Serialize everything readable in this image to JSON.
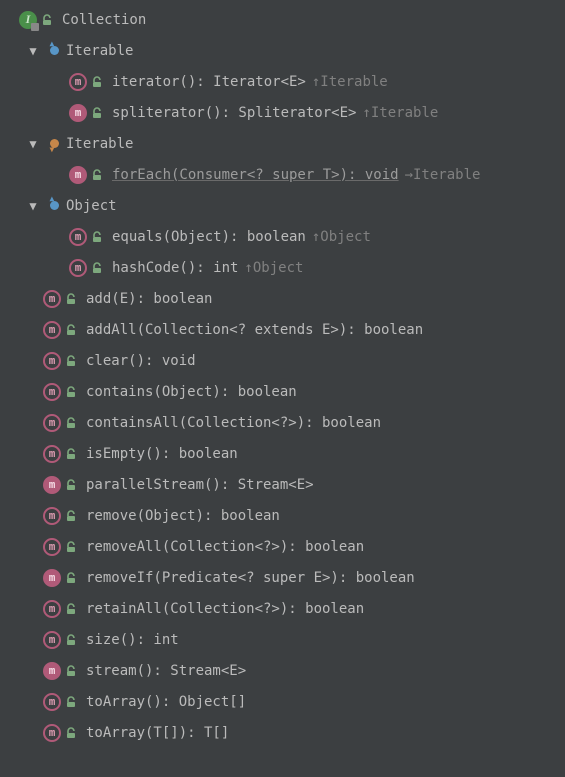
{
  "root": {
    "label": "Collection"
  },
  "groups": [
    {
      "label": "Iterable",
      "icon": "up-blue",
      "items": [
        {
          "abstract": true,
          "sig": "iterator(): Iterator<E>",
          "up": "↑Iterable"
        },
        {
          "abstract": false,
          "sig": "spliterator(): Spliterator<E>",
          "up": "↑Iterable"
        }
      ]
    },
    {
      "label": "Iterable",
      "icon": "down-orange",
      "items": [
        {
          "abstract": false,
          "sig": "forEach(Consumer<? super T>): void",
          "up": "→Iterable",
          "highlight": true
        }
      ]
    },
    {
      "label": "Object",
      "icon": "up-blue",
      "items": [
        {
          "abstract": true,
          "sig": "equals(Object): boolean",
          "up": "↑Object"
        },
        {
          "abstract": true,
          "sig": "hashCode(): int",
          "up": "↑Object"
        }
      ]
    }
  ],
  "methods": [
    {
      "abstract": true,
      "sig": "add(E): boolean"
    },
    {
      "abstract": true,
      "sig": "addAll(Collection<? extends E>): boolean"
    },
    {
      "abstract": true,
      "sig": "clear(): void"
    },
    {
      "abstract": true,
      "sig": "contains(Object): boolean"
    },
    {
      "abstract": true,
      "sig": "containsAll(Collection<?>): boolean"
    },
    {
      "abstract": true,
      "sig": "isEmpty(): boolean"
    },
    {
      "abstract": false,
      "sig": "parallelStream(): Stream<E>"
    },
    {
      "abstract": true,
      "sig": "remove(Object): boolean"
    },
    {
      "abstract": true,
      "sig": "removeAll(Collection<?>): boolean"
    },
    {
      "abstract": false,
      "sig": "removeIf(Predicate<? super E>): boolean"
    },
    {
      "abstract": true,
      "sig": "retainAll(Collection<?>): boolean"
    },
    {
      "abstract": true,
      "sig": "size(): int"
    },
    {
      "abstract": false,
      "sig": "stream(): Stream<E>"
    },
    {
      "abstract": true,
      "sig": "toArray(): Object[]"
    },
    {
      "abstract": true,
      "sig": "toArray(T[]): T[]"
    }
  ]
}
